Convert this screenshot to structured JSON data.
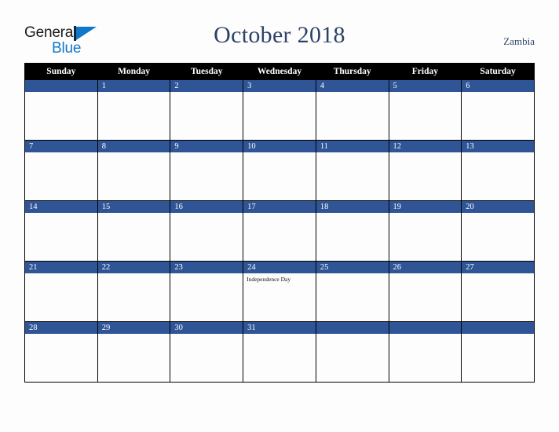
{
  "brand": {
    "name_part1": "General",
    "name_part2": "Blue",
    "triangle_color": "#1177c9",
    "text_color": "#1a1a1a"
  },
  "header": {
    "title": "October 2018",
    "region": "Zambia",
    "title_color": "#2d4268"
  },
  "calendar": {
    "weekday_headers": [
      "Sunday",
      "Monday",
      "Tuesday",
      "Wednesday",
      "Thursday",
      "Friday",
      "Saturday"
    ],
    "header_bg": "#000000",
    "daynum_bar_color": "#2f5597",
    "weeks": [
      [
        {
          "day": "",
          "events": []
        },
        {
          "day": "1",
          "events": []
        },
        {
          "day": "2",
          "events": []
        },
        {
          "day": "3",
          "events": []
        },
        {
          "day": "4",
          "events": []
        },
        {
          "day": "5",
          "events": []
        },
        {
          "day": "6",
          "events": []
        }
      ],
      [
        {
          "day": "7",
          "events": []
        },
        {
          "day": "8",
          "events": []
        },
        {
          "day": "9",
          "events": []
        },
        {
          "day": "10",
          "events": []
        },
        {
          "day": "11",
          "events": []
        },
        {
          "day": "12",
          "events": []
        },
        {
          "day": "13",
          "events": []
        }
      ],
      [
        {
          "day": "14",
          "events": []
        },
        {
          "day": "15",
          "events": []
        },
        {
          "day": "16",
          "events": []
        },
        {
          "day": "17",
          "events": []
        },
        {
          "day": "18",
          "events": []
        },
        {
          "day": "19",
          "events": []
        },
        {
          "day": "20",
          "events": []
        }
      ],
      [
        {
          "day": "21",
          "events": []
        },
        {
          "day": "22",
          "events": []
        },
        {
          "day": "23",
          "events": []
        },
        {
          "day": "24",
          "events": [
            "Independence Day"
          ]
        },
        {
          "day": "25",
          "events": []
        },
        {
          "day": "26",
          "events": []
        },
        {
          "day": "27",
          "events": []
        }
      ],
      [
        {
          "day": "28",
          "events": []
        },
        {
          "day": "29",
          "events": []
        },
        {
          "day": "30",
          "events": []
        },
        {
          "day": "31",
          "events": []
        },
        {
          "day": "",
          "events": []
        },
        {
          "day": "",
          "events": []
        },
        {
          "day": "",
          "events": []
        }
      ]
    ]
  }
}
